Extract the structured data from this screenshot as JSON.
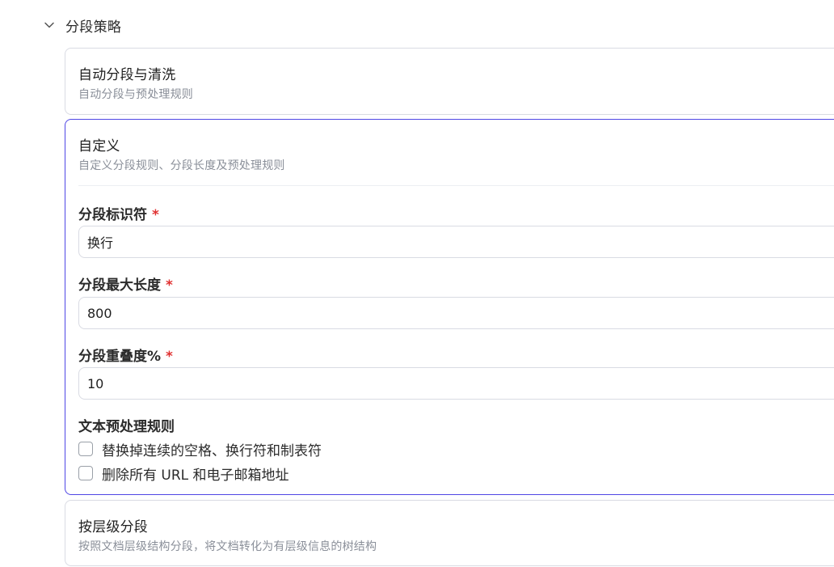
{
  "section": {
    "title": "分段策略",
    "chevron_icon": "chevron-down-icon"
  },
  "cards": {
    "auto": {
      "title": "自动分段与清洗",
      "description": "自动分段与预处理规则"
    },
    "custom": {
      "title": "自定义",
      "description": "自定义分段规则、分段长度及预处理规则",
      "fields": {
        "separator": {
          "label": "分段标识符",
          "required_mark": "*",
          "value": "换行"
        },
        "max_length": {
          "label": "分段最大长度",
          "required_mark": "*",
          "value": "800"
        },
        "overlap": {
          "label": "分段重叠度%",
          "required_mark": "*",
          "value": "10"
        }
      },
      "preprocess": {
        "label": "文本预处理规则",
        "options": [
          {
            "label": "替换掉连续的空格、换行符和制表符",
            "checked": false
          },
          {
            "label": "删除所有 URL 和电子邮箱地址",
            "checked": false
          }
        ]
      }
    },
    "hierarchy": {
      "title": "按层级分段",
      "description": "按照文档层级结构分段，将文档转化为有层级信息的树结构"
    }
  },
  "colors": {
    "accent": "#4f46e5",
    "required": "#e03131",
    "border": "#d9dbe3"
  }
}
